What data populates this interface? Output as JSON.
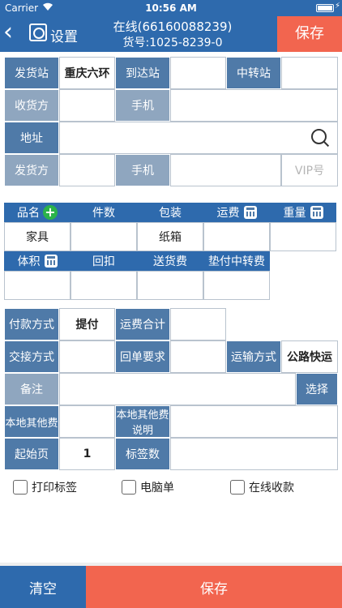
{
  "status": {
    "carrier": "Carrier",
    "time": "10:56 AM"
  },
  "nav": {
    "settings_label": "设置",
    "title_line1": "在线(66160088239)",
    "title_line2": "货号:1025-8239-0",
    "save_label": "保存"
  },
  "shipping": {
    "origin_label": "发货站",
    "origin_value": "重庆六环",
    "dest_label": "到达站",
    "dest_value": "",
    "transfer_label": "中转站",
    "transfer_value": "",
    "receiver_label": "收货方",
    "receiver_phone_label": "手机",
    "address_label": "地址",
    "sender_label": "发货方",
    "sender_phone_label": "手机",
    "vip_placeholder": "VIP号"
  },
  "goods": {
    "headers": [
      "品名",
      "件数",
      "包装",
      "运费",
      "重量"
    ],
    "row1": [
      "家具",
      "",
      "纸箱",
      "",
      ""
    ],
    "headers2": [
      "体积",
      "回扣",
      "送货费",
      "垫付中转费"
    ],
    "row2": [
      "",
      "",
      "",
      ""
    ]
  },
  "payment": {
    "pay_method_label": "付款方式",
    "pay_method_value": "提付",
    "freight_total_label": "运费合计",
    "handover_label": "交接方式",
    "receipt_label": "回单要求",
    "transport_label": "运输方式",
    "transport_value": "公路快运",
    "remark_label": "备注",
    "select_label": "选择",
    "local_other_fee_label": "本地其他费",
    "local_other_fee_desc_label": "本地其他费说明",
    "start_page_label": "起始页",
    "start_page_value": "1",
    "sign_count_label": "标签数"
  },
  "options": {
    "print_label": "打印标签",
    "computer_order": "电脑单",
    "online_payment": "在线收款"
  },
  "bottom": {
    "clear_label": "清空",
    "save_label": "保存"
  },
  "colors": {
    "header_blue": "#2e6aad",
    "label_blue": "#4f7aa8",
    "accent_red": "#f2654f"
  }
}
